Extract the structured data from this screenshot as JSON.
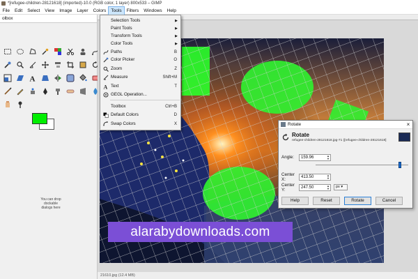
{
  "window": {
    "title": "*[refugee-children-28121618] (imported)-10.0 (RGB color, 1 layer) 800x533 – GIMP"
  },
  "menubar": [
    "File",
    "Edit",
    "Select",
    "View",
    "Image",
    "Layer",
    "Colors",
    "Tools",
    "Filters",
    "Windows",
    "Help"
  ],
  "toolbox": {
    "title": "olbox",
    "drop_hint": "You can drop dockable dialogs here",
    "fg_color": "#00ee00",
    "bg_color": "#ffffff"
  },
  "tools_menu": [
    {
      "label": "Selection Tools",
      "shortcut": "",
      "submenu": true
    },
    {
      "label": "Paint Tools",
      "shortcut": "",
      "submenu": true
    },
    {
      "label": "Transform Tools",
      "shortcut": "",
      "submenu": true
    },
    {
      "label": "Color Tools",
      "shortcut": "",
      "submenu": true
    },
    {
      "label": "Paths",
      "shortcut": "B",
      "submenu": false
    },
    {
      "label": "Color Picker",
      "shortcut": "O",
      "submenu": false
    },
    {
      "label": "Zoom",
      "shortcut": "Z",
      "submenu": false
    },
    {
      "label": "Measure",
      "shortcut": "Shift+M",
      "submenu": false
    },
    {
      "label": "Text",
      "shortcut": "T",
      "submenu": false
    },
    {
      "label": "GEGL Operation...",
      "shortcut": "",
      "submenu": false
    },
    {
      "label": "Toolbox",
      "shortcut": "Ctrl+B",
      "submenu": false
    },
    {
      "label": "Default Colors",
      "shortcut": "D",
      "submenu": false
    },
    {
      "label": "Swap Colors",
      "shortcut": "X",
      "submenu": false
    }
  ],
  "rotate_dialog": {
    "window_title": "Rotate",
    "heading": "Rotate",
    "subheading": "refugee-children-28121618.jpg-71 ([refugee-children-28121618]",
    "angle_label": "Angle:",
    "angle_value": "159.96",
    "center_x_label": "Center X:",
    "center_x_value": "413.50",
    "center_y_label": "Center Y:",
    "center_y_value": "247.50",
    "unit": "px",
    "buttons": {
      "help": "Help",
      "reset": "Reset",
      "rotate": "Rotate",
      "cancel": "Cancel"
    }
  },
  "status": {
    "text": "21610.jpg (12.4 MB)"
  },
  "watermark": "alarabydownloads.com"
}
